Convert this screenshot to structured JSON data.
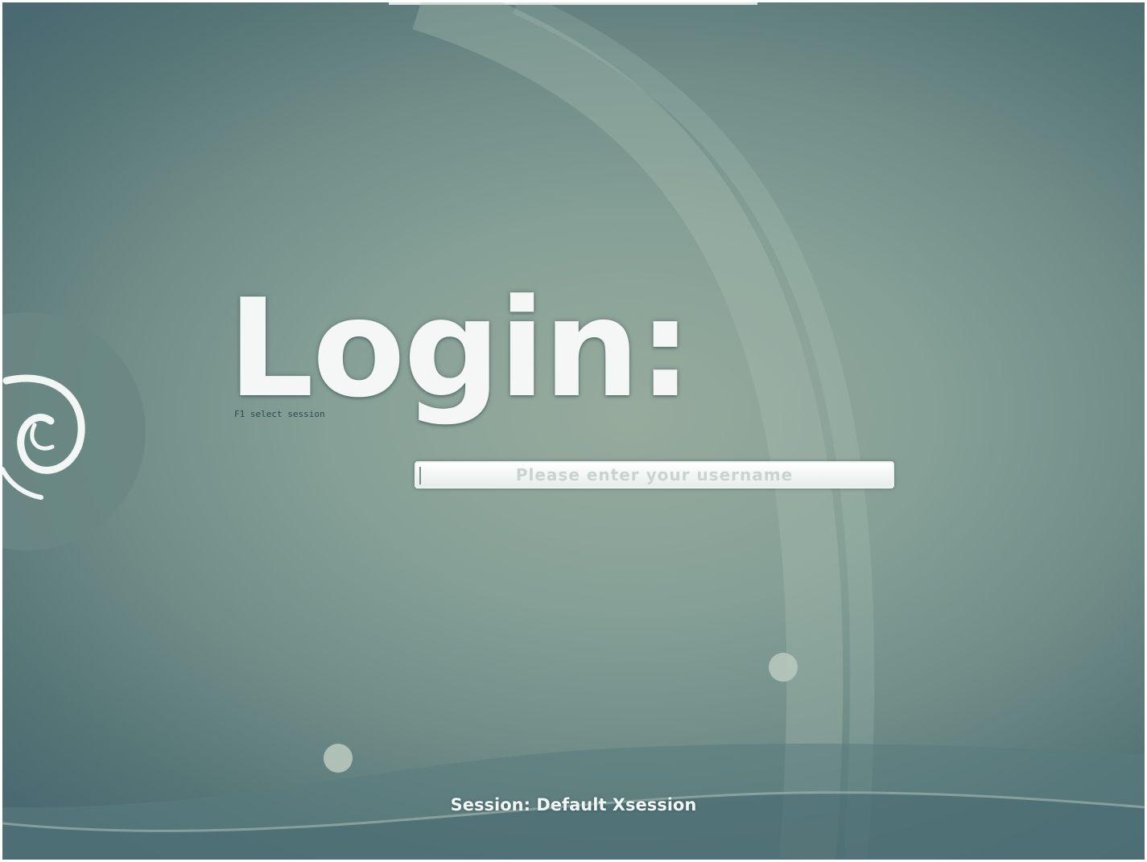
{
  "login": {
    "title": "Login:",
    "hint": "F1 select session",
    "username_placeholder": "Please enter your username"
  },
  "session": {
    "label": "Session: Default Xsession"
  },
  "icons": {
    "logo": "debian-swirl-logo"
  },
  "colors": {
    "background_light": "#97ab9d",
    "background_dark": "#4a6a72",
    "text": "#f4f7f6"
  }
}
